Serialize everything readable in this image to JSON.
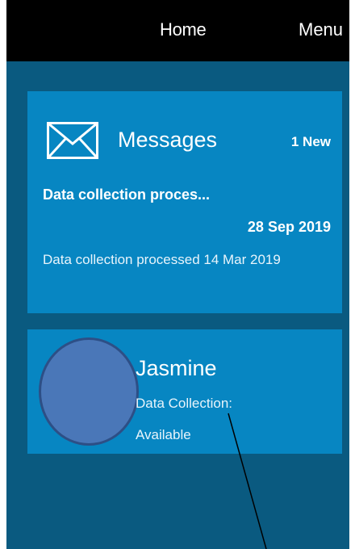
{
  "header": {
    "title": "Home",
    "menu_label": "Menu"
  },
  "messages_card": {
    "title": "Messages",
    "new_count": "1 New",
    "latest_subject": "Data collection proces...",
    "latest_date": "28 Sep 2019",
    "previous_item": "Data collection processed  14 Mar 2019",
    "icon": "envelope-icon"
  },
  "user_card": {
    "name": "Jasmine",
    "status_label": "Data Collection:",
    "status_value": "Available"
  },
  "colors": {
    "background": "#0a5a80",
    "card": "#0786c2",
    "topbar": "#000000",
    "avatar": "#4a77b8"
  }
}
